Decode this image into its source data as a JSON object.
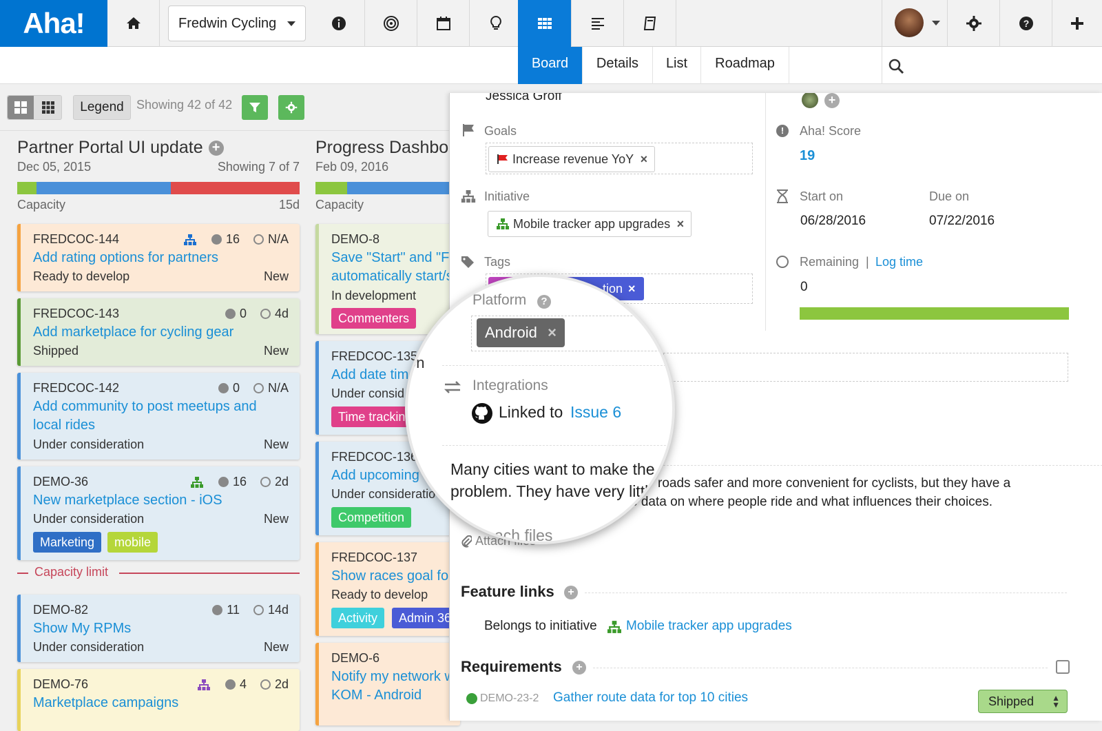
{
  "app": {
    "logo": "Aha!"
  },
  "topnav": {
    "product": "Fredwin Cycling",
    "icons": [
      "home-icon",
      "info-icon",
      "target-icon",
      "calendar-icon",
      "lightbulb-icon",
      "grid-icon",
      "list-icon",
      "notebook-icon"
    ]
  },
  "subnav": {
    "tabs": [
      "Board",
      "Details",
      "List",
      "Roadmap"
    ]
  },
  "toolbar": {
    "legend": "Legend",
    "showing": "Showing 42 of 42"
  },
  "columns": [
    {
      "title": "Partner Portal UI update",
      "date": "Dec 05, 2015",
      "showing": "Showing 7 of 7",
      "capacity_label": "Capacity",
      "capacity_value": "15d",
      "capacity_limit": "Capacity limit",
      "cards": [
        {
          "id": "FREDCOC-144",
          "title": "Add rating options for partners",
          "status": "Ready to develop",
          "type": "New",
          "score": "16",
          "time": "N/A"
        },
        {
          "id": "FREDCOC-143",
          "title": "Add marketplace for cycling gear",
          "status": "Shipped",
          "type": "New",
          "score": "0",
          "time": "4d"
        },
        {
          "id": "FREDCOC-142",
          "title": "Add community to post meetups and local rides",
          "status": "Under consideration",
          "type": "New",
          "score": "0",
          "time": "N/A"
        },
        {
          "id": "DEMO-36",
          "title": "New marketplace section - iOS",
          "status": "Under consideration",
          "type": "New",
          "score": "16",
          "time": "2d",
          "tags": [
            "Marketing",
            "mobile"
          ]
        },
        {
          "id": "DEMO-82",
          "title": "Show My RPMs",
          "status": "Under consideration",
          "type": "New",
          "score": "11",
          "time": "14d"
        },
        {
          "id": "DEMO-76",
          "title": "Marketplace campaigns",
          "score": "4",
          "time": "2d"
        }
      ]
    },
    {
      "title": "Progress Dashbo",
      "date": "Feb 09, 2016",
      "capacity_label": "Capacity",
      "cards": [
        {
          "id": "DEMO-8",
          "title_l1": "Save \"Start\" and \"F",
          "title_l2": "automatically start/s",
          "status": "In development",
          "tags": [
            "Commenters"
          ]
        },
        {
          "id": "FREDCOC-135",
          "title": "Add date tim",
          "status": "Under consid",
          "tags": [
            "Time trackin"
          ]
        },
        {
          "id": "FREDCOC-136",
          "title": "Add upcoming",
          "status": "Under consideratio",
          "tags": [
            "Competition"
          ]
        },
        {
          "id": "FREDCOC-137",
          "title": "Show races goal fo",
          "status": "Ready to develop",
          "tags": [
            "Activity",
            "Admin 36"
          ]
        },
        {
          "id": "DEMO-6",
          "title_l1": "Notify my network w",
          "title_l2": "KOM - Android"
        }
      ]
    }
  ],
  "panel": {
    "assignee": "Jessica Groff",
    "goals_label": "Goals",
    "goal": "Increase revenue YoY",
    "initiative_label": "Initiative",
    "initiative": "Mobile tracker app upgrades",
    "tags_label": "Tags",
    "tag_partial": "tion",
    "score_label": "Aha! Score",
    "score": "19",
    "start_label": "Start on",
    "start": "06/28/2016",
    "due_label": "Due on",
    "due": "07/22/2016",
    "remaining_label": "Remaining",
    "log_time": "Log time",
    "remaining": "0",
    "description_l1": "roads safer and more convenient for cyclists, but they have a",
    "description_l2": "e data on where people ride and what influences their choices.",
    "attach": "Attach files",
    "feature_links_label": "Feature links",
    "belongs": "Belongs to initiative",
    "belongs_link": "Mobile tracker app upgrades",
    "requirements_label": "Requirements",
    "req_id": "DEMO-23-2",
    "req_title": "Gather route data for top 10 cities",
    "req_status": "Shipped"
  },
  "magnifier": {
    "platform_label": "Platform",
    "platform_value": "Android",
    "integrations_label": "Integrations",
    "linked_text": "Linked to",
    "linked_issue": "Issue 6",
    "desc_l1": "Many cities want to make the",
    "desc_l2": "problem. They have very littl",
    "attach": "ach files",
    "partial_left": "on"
  },
  "colors": {
    "brand": "#0074d0",
    "link": "#1a8fd6",
    "success": "#8cc63f",
    "danger": "#e04b4b"
  }
}
